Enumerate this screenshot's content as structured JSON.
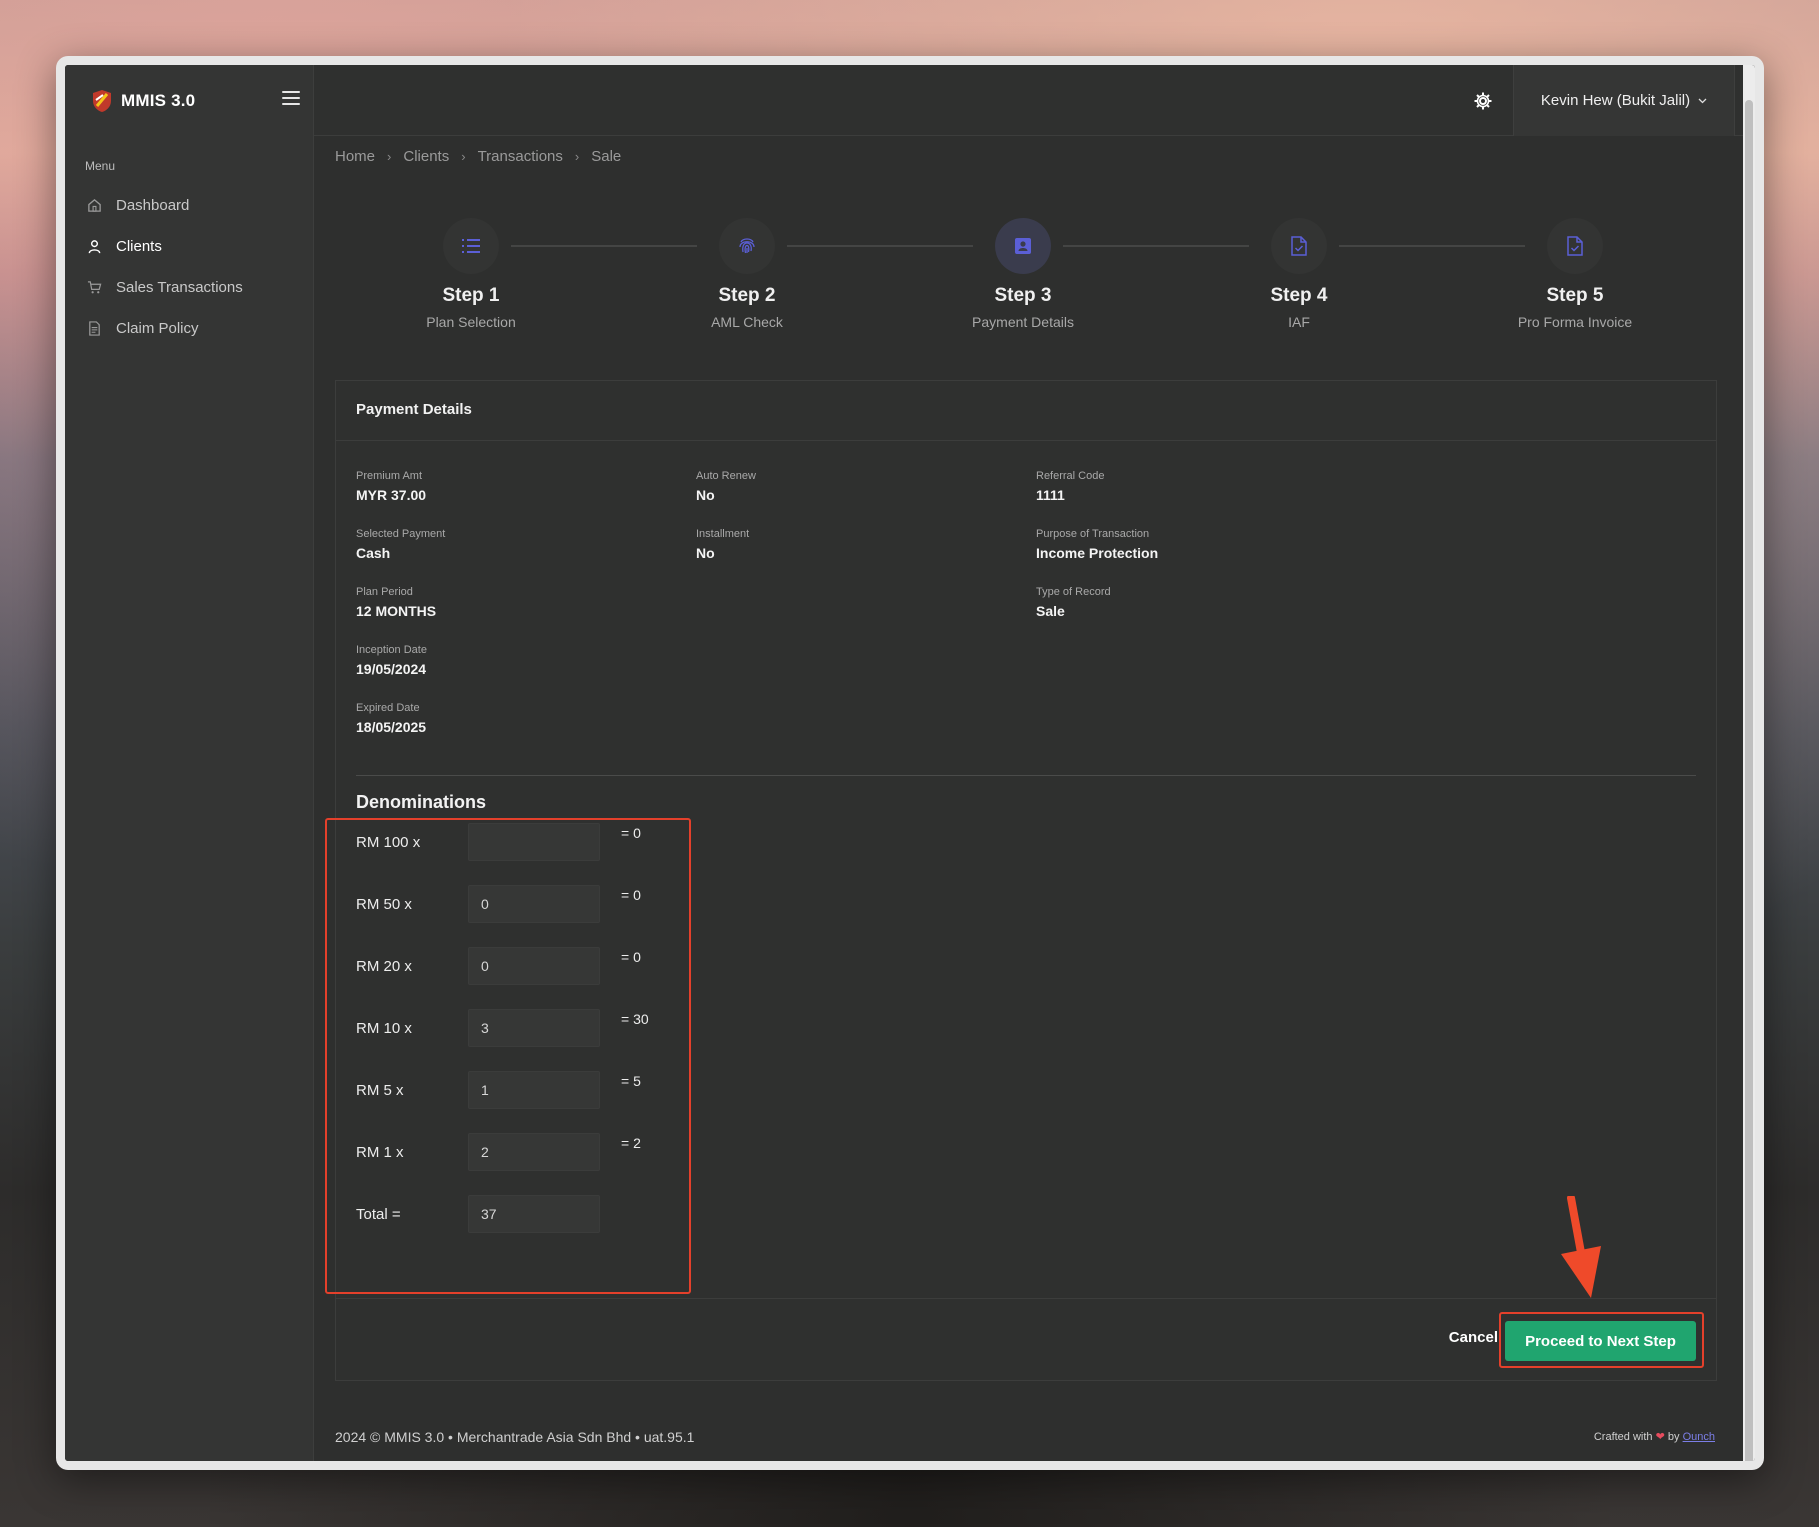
{
  "app": {
    "name": "MMIS 3.0"
  },
  "sidebar": {
    "menu_title": "Menu",
    "items": [
      {
        "label": "Dashboard",
        "icon": "home-icon"
      },
      {
        "label": "Clients",
        "icon": "user-icon",
        "active": true
      },
      {
        "label": "Sales Transactions",
        "icon": "cart-icon"
      },
      {
        "label": "Claim Policy",
        "icon": "document-icon"
      }
    ]
  },
  "topbar": {
    "user_name": "Kevin Hew (Bukit Jalil)"
  },
  "breadcrumb": [
    "Home",
    "Clients",
    "Transactions",
    "Sale"
  ],
  "steps": [
    {
      "title": "Step 1",
      "subtitle": "Plan Selection",
      "icon": "list-icon"
    },
    {
      "title": "Step 2",
      "subtitle": "AML Check",
      "icon": "fingerprint-icon"
    },
    {
      "title": "Step 3",
      "subtitle": "Payment Details",
      "icon": "contact-card-icon",
      "active": true
    },
    {
      "title": "Step 4",
      "subtitle": "IAF",
      "icon": "file-check-icon"
    },
    {
      "title": "Step 5",
      "subtitle": "Pro Forma Invoice",
      "icon": "file-check-icon"
    }
  ],
  "payment": {
    "title": "Payment Details",
    "premium_amt_label": "Premium Amt",
    "premium_amt": "MYR 37.00",
    "selected_payment_label": "Selected Payment",
    "selected_payment": "Cash",
    "plan_period_label": "Plan Period",
    "plan_period": "12 MONTHS",
    "inception_date_label": "Inception Date",
    "inception_date": "19/05/2024",
    "expired_date_label": "Expired Date",
    "expired_date": "18/05/2025",
    "auto_renew_label": "Auto Renew",
    "auto_renew": "No",
    "installment_label": "Installment",
    "installment": "No",
    "referral_code_label": "Referral Code",
    "referral_code": "1111",
    "purpose_label": "Purpose of Transaction",
    "purpose": "Income Protection",
    "type_label": "Type of Record",
    "type": "Sale"
  },
  "denominations": {
    "title": "Denominations",
    "rows": [
      {
        "label": "RM 100 x",
        "value": "",
        "result": "= 0"
      },
      {
        "label": "RM 50 x",
        "value": "0",
        "result": "= 0"
      },
      {
        "label": "RM 20 x",
        "value": "0",
        "result": "= 0"
      },
      {
        "label": "RM 10 x",
        "value": "3",
        "result": "= 30"
      },
      {
        "label": "RM 5 x",
        "value": "1",
        "result": "= 5"
      },
      {
        "label": "RM 1 x",
        "value": "2",
        "result": "= 2"
      }
    ],
    "total_label": "Total =",
    "total_value": "37"
  },
  "actions": {
    "cancel": "Cancel",
    "proceed": "Proceed to Next Step"
  },
  "footer": {
    "copyright": "2024 © MMIS 3.0 • Merchantrade Asia Sdn Bhd • uat.95.1",
    "crafted_prefix": "Crafted with",
    "heart": "❤",
    "crafted_by": "by",
    "author": "Ounch"
  },
  "colors": {
    "accent": "#5b5fd6",
    "proceed": "#20a56f",
    "highlight": "#e4402b"
  }
}
